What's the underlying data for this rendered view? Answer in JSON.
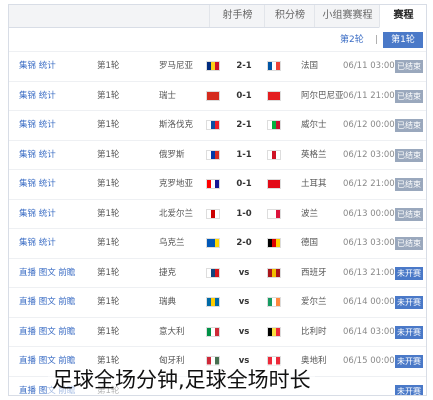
{
  "tabs": [
    "赛程",
    "小组赛赛程",
    "积分榜",
    "射手榜"
  ],
  "subnav": {
    "active": "第1轮",
    "sep": "|",
    "link": "第2轮"
  },
  "rows": [
    {
      "links": "集锦 统计",
      "league": "第1轮",
      "away": "罗马尼亚",
      "score": "2-1",
      "home": "法国",
      "time": "06/11 03:00",
      "status": "已结束",
      "state": "done",
      "fa": [
        "#002b7f",
        "#fcd116",
        "#ce1126"
      ],
      "fh": [
        "#0055a4",
        "#ffffff",
        "#ef4135"
      ]
    },
    {
      "links": "集锦 统计",
      "league": "第1轮",
      "away": "瑞士",
      "score": "0-1",
      "home": "阿尔巴尼亚",
      "time": "06/11 21:00",
      "status": "已结束",
      "state": "done",
      "fa": [
        "#d52b1e",
        "#d52b1e",
        "#d52b1e"
      ],
      "fh": [
        "#e41e20",
        "#e41e20",
        "#e41e20"
      ]
    },
    {
      "links": "集锦 统计",
      "league": "第1轮",
      "away": "斯洛伐克",
      "score": "2-1",
      "home": "威尔士",
      "time": "06/12 00:00",
      "status": "已结束",
      "state": "done",
      "fa": [
        "#ffffff",
        "#0b4ea2",
        "#ee1c25"
      ],
      "fh": [
        "#ffffff",
        "#00b140",
        "#c8102e"
      ]
    },
    {
      "links": "集锦 统计",
      "league": "第1轮",
      "away": "俄罗斯",
      "score": "1-1",
      "home": "英格兰",
      "time": "06/12 03:00",
      "status": "已结束",
      "state": "done",
      "fa": [
        "#ffffff",
        "#0039a6",
        "#d52b1e"
      ],
      "fh": [
        "#ffffff",
        "#ce1124",
        "#ffffff"
      ]
    },
    {
      "links": "集锦 统计",
      "league": "第1轮",
      "away": "克罗地亚",
      "score": "0-1",
      "home": "土耳其",
      "time": "06/12 21:00",
      "status": "已结束",
      "state": "done",
      "fa": [
        "#ff0000",
        "#ffffff",
        "#171796"
      ],
      "fh": [
        "#e30a17",
        "#e30a17",
        "#e30a17"
      ]
    },
    {
      "links": "集锦 统计",
      "league": "第1轮",
      "away": "北爱尔兰",
      "score": "1-0",
      "home": "波兰",
      "time": "06/13 00:00",
      "status": "已结束",
      "state": "done",
      "fa": [
        "#ffffff",
        "#cc0000",
        "#ffffff"
      ],
      "fh": [
        "#ffffff",
        "#ffffff",
        "#dc143c"
      ]
    },
    {
      "links": "集锦 统计",
      "league": "第1轮",
      "away": "乌克兰",
      "score": "2-0",
      "home": "德国",
      "time": "06/13 03:00",
      "status": "已结束",
      "state": "done",
      "fa": [
        "#0057b7",
        "#0057b7",
        "#ffd700"
      ],
      "fh": [
        "#000000",
        "#dd0000",
        "#ffce00"
      ]
    },
    {
      "links": "直播 图文 前瞻",
      "league": "第1轮",
      "away": "捷克",
      "score": "vs",
      "home": "西班牙",
      "time": "06/13 21:00",
      "status": "未开赛",
      "state": "todo",
      "fa": [
        "#ffffff",
        "#11457e",
        "#d7141a"
      ],
      "fh": [
        "#aa151b",
        "#f1bf00",
        "#aa151b"
      ]
    },
    {
      "links": "直播 图文 前瞻",
      "league": "第1轮",
      "away": "瑞典",
      "score": "vs",
      "home": "爱尔兰",
      "time": "06/14 00:00",
      "status": "未开赛",
      "state": "todo",
      "fa": [
        "#006aa7",
        "#fecc00",
        "#006aa7"
      ],
      "fh": [
        "#169b62",
        "#ffffff",
        "#ff883e"
      ]
    },
    {
      "links": "直播 图文 前瞻",
      "league": "第1轮",
      "away": "意大利",
      "score": "vs",
      "home": "比利时",
      "time": "06/14 03:00",
      "status": "未开赛",
      "state": "todo",
      "fa": [
        "#009246",
        "#ffffff",
        "#ce2b37"
      ],
      "fh": [
        "#000000",
        "#fae042",
        "#ed2939"
      ]
    },
    {
      "links": "直播 图文 前瞻",
      "league": "第1轮",
      "away": "匈牙利",
      "score": "vs",
      "home": "奥地利",
      "time": "06/15 00:00",
      "status": "未开赛",
      "state": "todo",
      "fa": [
        "#ce2939",
        "#ffffff",
        "#477050"
      ],
      "fh": [
        "#ed2939",
        "#ffffff",
        "#ed2939"
      ]
    },
    {
      "links": "直播 图文 前瞻",
      "league": "第1轮",
      "away": "",
      "score": "",
      "home": "",
      "time": "",
      "status": "未开赛",
      "state": "todo",
      "fa": [],
      "fh": []
    }
  ],
  "caption": "足球全场分钟,足球全场时长"
}
